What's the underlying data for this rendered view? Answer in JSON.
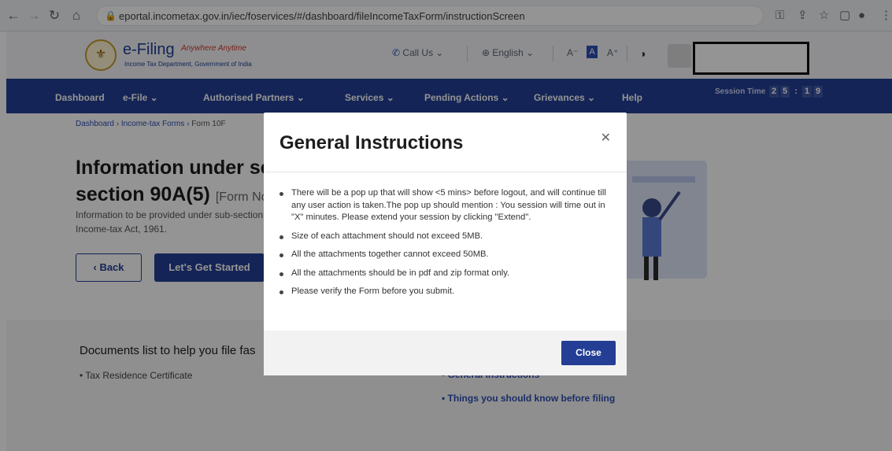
{
  "browser": {
    "url": "eportal.incometax.gov.in/iec/foservices/#/dashboard/fileIncomeTaxForm/instructionScreen"
  },
  "header": {
    "logo_main": "e-Filing",
    "logo_tag": "Anywhere Anytime",
    "logo_sub": "Income Tax Department, Government of India",
    "call_us": "Call Us",
    "language": "English",
    "text_decrease": "A⁻",
    "text_normal": "A",
    "text_increase": "A⁺"
  },
  "nav": {
    "items": [
      "Dashboard",
      "e-File",
      "Authorised Partners",
      "Services",
      "Pending Actions",
      "Grievances",
      "Help"
    ],
    "session_label": "Session Time",
    "session_digits": [
      "2",
      "5",
      ":",
      "1",
      "9"
    ]
  },
  "breadcrumb": [
    "Dashboard",
    "Income-tax Forms",
    "Form 10F"
  ],
  "hero": {
    "title_line1": "Information under sec",
    "title_line2": "section 90A(5)",
    "form_tag": "[Form No.",
    "description": "Information to be provided under sub-section section 90A of the Income-tax Act, 1961.",
    "back_label": "Back",
    "start_label": "Let's Get Started"
  },
  "documents": {
    "title": "Documents list to help you file fas",
    "items": [
      "Tax Residence Certificate"
    ],
    "links": [
      "General Instructions",
      "Things you should know before filing"
    ]
  },
  "modal": {
    "title": "General Instructions",
    "instructions": [
      "There will be a pop up that will show <5 mins> before logout, and will continue till any user action is taken.The pop up should mention : You session will time out in \"X\" minutes. Please extend your session by clicking \"Extend\".",
      "Size of each attachment should not exceed 5MB.",
      "All the attachments together cannot exceed 50MB.",
      "All the attachments should be in pdf and zip format only.",
      "Please verify the Form before you submit."
    ],
    "close_label": "Close"
  }
}
